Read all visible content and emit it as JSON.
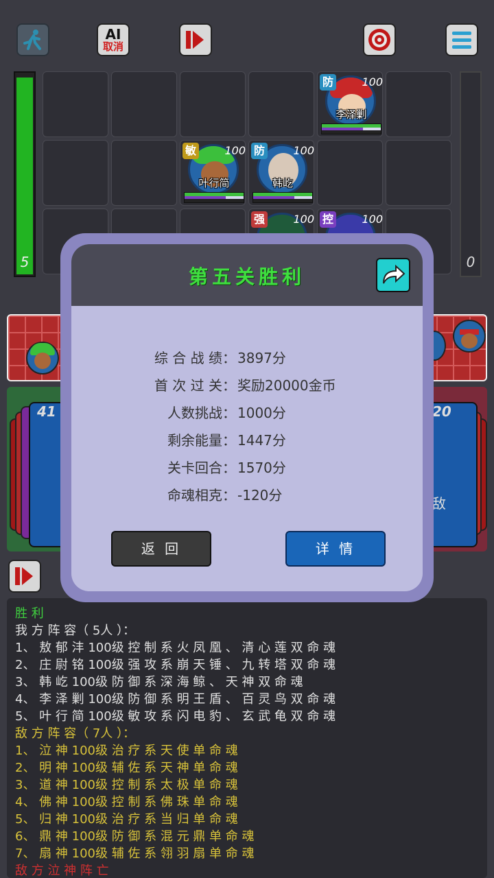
{
  "top_bar": {
    "ai_label_top": "AI",
    "ai_label_bottom": "取消"
  },
  "energy": {
    "left_value": "5",
    "right_value": "0",
    "left_fill_fraction": 0.97
  },
  "board_units": [
    {
      "tag": "防",
      "tag_color": "#2a8fc0",
      "level": "100",
      "name": "李泽剿"
    },
    {
      "tag": "敏",
      "tag_color": "#c09a1a",
      "level": "100",
      "name": "叶行简"
    },
    {
      "tag": "防",
      "tag_color": "#2a8fc0",
      "level": "100",
      "name": "韩屹"
    },
    {
      "tag": "强",
      "tag_color": "#c03a3a",
      "level": "100",
      "name": ""
    },
    {
      "tag": "控",
      "tag_color": "#7a3fbf",
      "level": "100",
      "name": ""
    }
  ],
  "decks": {
    "left_count": "41",
    "right_count": "20",
    "right_partial_label": "敌"
  },
  "dialog": {
    "title": "第五关胜利",
    "share_icon": "share-arrow-icon",
    "stats": [
      {
        "label": "综 合 战 绩：",
        "value": "3897分"
      },
      {
        "label": "首 次 过 关：",
        "value": "奖励20000金币"
      },
      {
        "label": "人数挑战：",
        "value": "1000分"
      },
      {
        "label": "剩余能量：",
        "value": "1447分"
      },
      {
        "label": "关卡回合：",
        "value": "1570分"
      },
      {
        "label": "命魂相克：",
        "value": "-120分"
      }
    ],
    "back_label": "返 回",
    "detail_label": "详 情"
  },
  "log": {
    "result": "胜 利",
    "ally_header": "我 方 阵 容（ 5人 ）：",
    "ally_lines": [
      "1、 敖 郁 沣  100级  控 制 系  火 凤 凰 、 清 心 莲 双 命 魂",
      "2、 庄 尉 铭  100级  强 攻 系  崩 天 锤 、 九 转 塔 双 命 魂",
      "3、 韩 屹  100级  防 御 系  深 海 鲸 、 天 神 双 命 魂",
      "4、 李 泽 剿  100级  防 御 系  明 王 盾 、 百 灵 鸟 双 命 魂",
      "5、 叶 行 简  100级  敏 攻 系  闪 电 豹 、 玄 武 龟 双 命 魂"
    ],
    "enemy_header": "敌 方 阵 容（ 7人 ）：",
    "enemy_lines": [
      "1、 泣 神  100级  治 疗 系  天 使 单 命 魂",
      "2、 明 神  100级  辅 佐 系  天 神 单 命 魂",
      "3、 道 神  100级  控 制 系  太 极 单 命 魂",
      "4、 佛 神  100级  控 制 系  佛 珠 单 命 魂",
      "5、 归 神  100级  治 疗 系  当 归 单 命 魂",
      "6、 鼎 神  100级  防 御 系  混 元 鼎 单 命 魂",
      "7、 扇 神  100级  辅 佐 系  翎 羽 扇 单 命 魂"
    ],
    "cut_line": "敌 方 泣 神 阵 亡"
  },
  "colors": {
    "ally_text": "#e0e0e0",
    "enemy_text": "#d8c23a",
    "victory_text": "#3fcf3f",
    "dialog_title": "#3fdf3f"
  }
}
